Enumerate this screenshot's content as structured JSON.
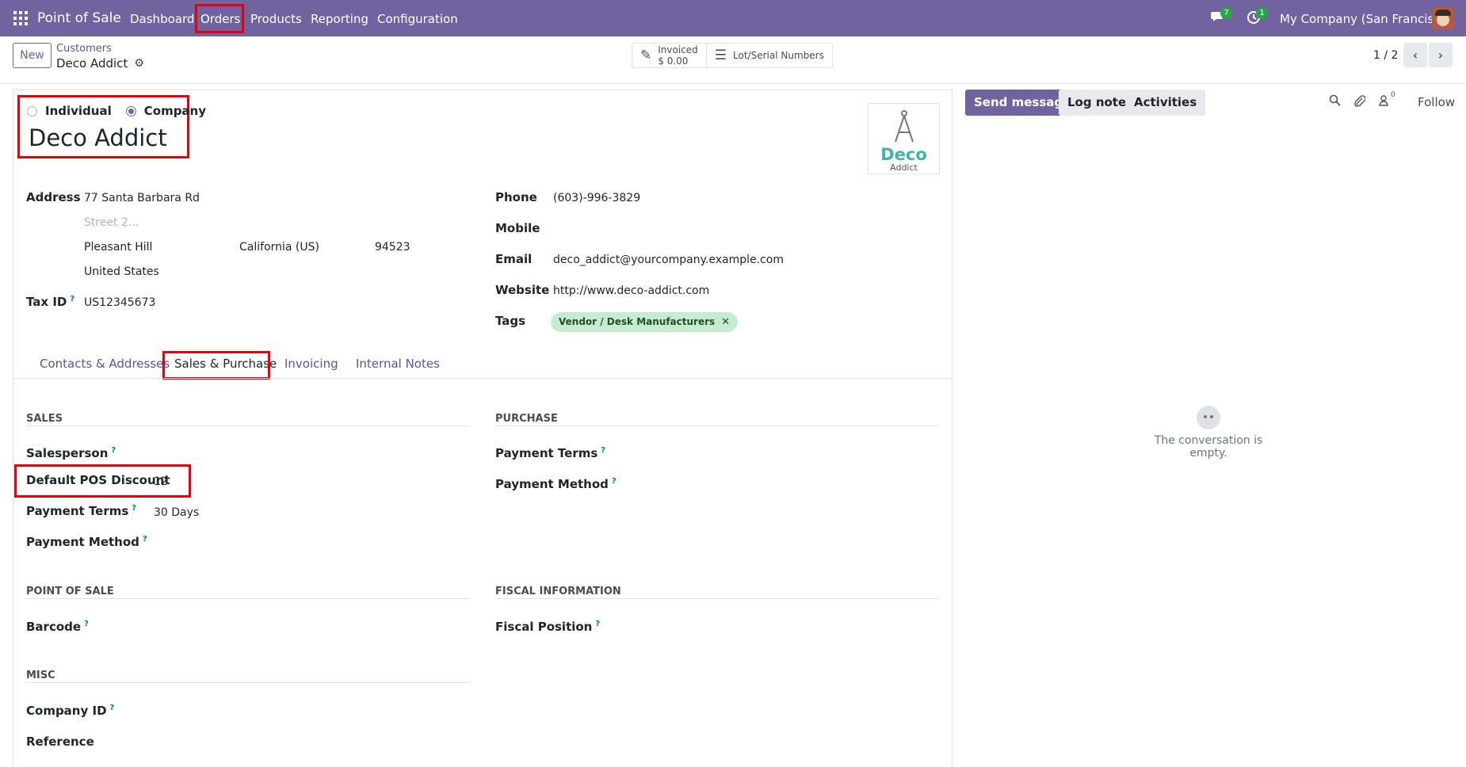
{
  "navbar": {
    "app_title": "Point of Sale",
    "menu": [
      "Dashboard",
      "Orders",
      "Products",
      "Reporting",
      "Configuration"
    ],
    "messages_badge": "7",
    "activities_badge": "1",
    "company": "My Company (San Francisco)"
  },
  "control_panel": {
    "new_label": "New",
    "breadcrumb_parent": "Customers",
    "breadcrumb_current": "Deco Addict",
    "smart_buttons": {
      "invoiced_label": "Invoiced",
      "invoiced_value": "$ 0.00",
      "lot_label": "Lot/Serial Numbers"
    },
    "pager": "1 / 2"
  },
  "form": {
    "type_options": [
      "Individual",
      "Company"
    ],
    "selected_type": "Company",
    "name": "Deco Addict",
    "logo_text": "Deco",
    "logo_subtext": "Addict",
    "address": {
      "label": "Address",
      "street": "77 Santa Barbara Rd",
      "street2_placeholder": "Street 2...",
      "city": "Pleasant Hill",
      "state": "California (US)",
      "zip": "94523",
      "country": "United States"
    },
    "tax_id": {
      "label": "Tax ID",
      "value": "US12345673"
    },
    "phone": {
      "label": "Phone",
      "value": "(603)-996-3829"
    },
    "mobile": {
      "label": "Mobile",
      "value": ""
    },
    "email": {
      "label": "Email",
      "value": "deco_addict@yourcompany.example.com"
    },
    "website": {
      "label": "Website",
      "value": "http://www.deco-addict.com"
    },
    "tags": {
      "label": "Tags",
      "items": [
        "Vendor / Desk Manufacturers"
      ]
    },
    "help_mark": "?"
  },
  "tabs": {
    "items": [
      "Contacts & Addresses",
      "Sales & Purchase",
      "Invoicing",
      "Internal Notes"
    ],
    "active": "Sales & Purchase"
  },
  "sales": {
    "title": "SALES",
    "salesperson_label": "Salesperson",
    "discount_label": "Default POS Discount",
    "discount_value": "12",
    "payment_terms_label": "Payment Terms",
    "payment_terms_value": "30 Days",
    "payment_method_label": "Payment Method"
  },
  "purchase": {
    "title": "PURCHASE",
    "payment_terms_label": "Payment Terms",
    "payment_method_label": "Payment Method"
  },
  "pos": {
    "title": "POINT OF SALE",
    "barcode_label": "Barcode"
  },
  "fiscal": {
    "title": "FISCAL INFORMATION",
    "fiscal_position_label": "Fiscal Position"
  },
  "misc": {
    "title": "MISC",
    "company_id_label": "Company ID",
    "reference_label": "Reference"
  },
  "chatter": {
    "send_message": "Send message",
    "log_note": "Log note",
    "activities": "Activities",
    "followers_count": "0",
    "follow": "Follow",
    "empty_text": "The conversation is empty."
  },
  "colors": {
    "brand": "#71639e",
    "highlight": "#e0000f",
    "tag_bg": "#c9ecd1"
  }
}
